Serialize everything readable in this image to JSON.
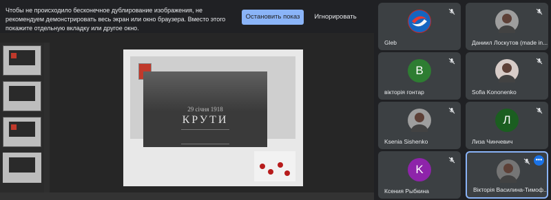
{
  "banner": {
    "message": "Чтобы не происходило бесконечное дублирование изображения, не рекомендуем демонстрировать весь экран или окно браузера. Вместо этого покажите отдельную вкладку или другое окно.",
    "stop_label": "Остановить показ",
    "ignore_label": "Игнорировать"
  },
  "slide": {
    "subtitle": "29 січня 1918",
    "title": "КРУТИ"
  },
  "participants": [
    {
      "name": "Gleb",
      "avatar": "logo",
      "avatar_color": "#c62828",
      "muted": true
    },
    {
      "name": "Даниил Лоскутов (made in...",
      "avatar": "photo",
      "avatar_color": "#9e9e9e",
      "muted": true
    },
    {
      "name": "вікторія гонтар",
      "avatar": "В",
      "avatar_color": "#2e7d32",
      "muted": true
    },
    {
      "name": "Sofia Kononenko",
      "avatar": "photo",
      "avatar_color": "#d7ccc8",
      "muted": true
    },
    {
      "name": "Ksenia Sishenko",
      "avatar": "photo",
      "avatar_color": "#9e9e9e",
      "muted": true
    },
    {
      "name": "Лиза Чинчевич",
      "avatar": "Л",
      "avatar_color": "#1b5e20",
      "muted": true
    },
    {
      "name": "Ксения Рыбкина",
      "avatar": "K",
      "avatar_color": "#8e24aa",
      "muted": true
    },
    {
      "name": "Вікторія Василина-Тимоф...",
      "avatar": "photo",
      "avatar_color": "#757575",
      "muted": true,
      "active": true
    }
  ],
  "colors": {
    "accent": "#8ab4f8",
    "tile_bg": "#3c4043",
    "page_bg": "#202124"
  }
}
